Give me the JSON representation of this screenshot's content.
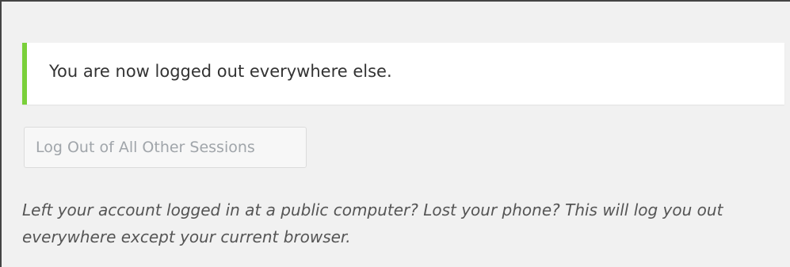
{
  "notice": {
    "message": "You are now logged out everywhere else."
  },
  "sessions": {
    "button_label": "Log Out of All Other Sessions",
    "description": "Left your account logged in at a public computer? Lost your phone? This will log you out everywhere except your current browser."
  },
  "colors": {
    "notice_accent": "#7ad03a",
    "background": "#f1f1f1"
  }
}
